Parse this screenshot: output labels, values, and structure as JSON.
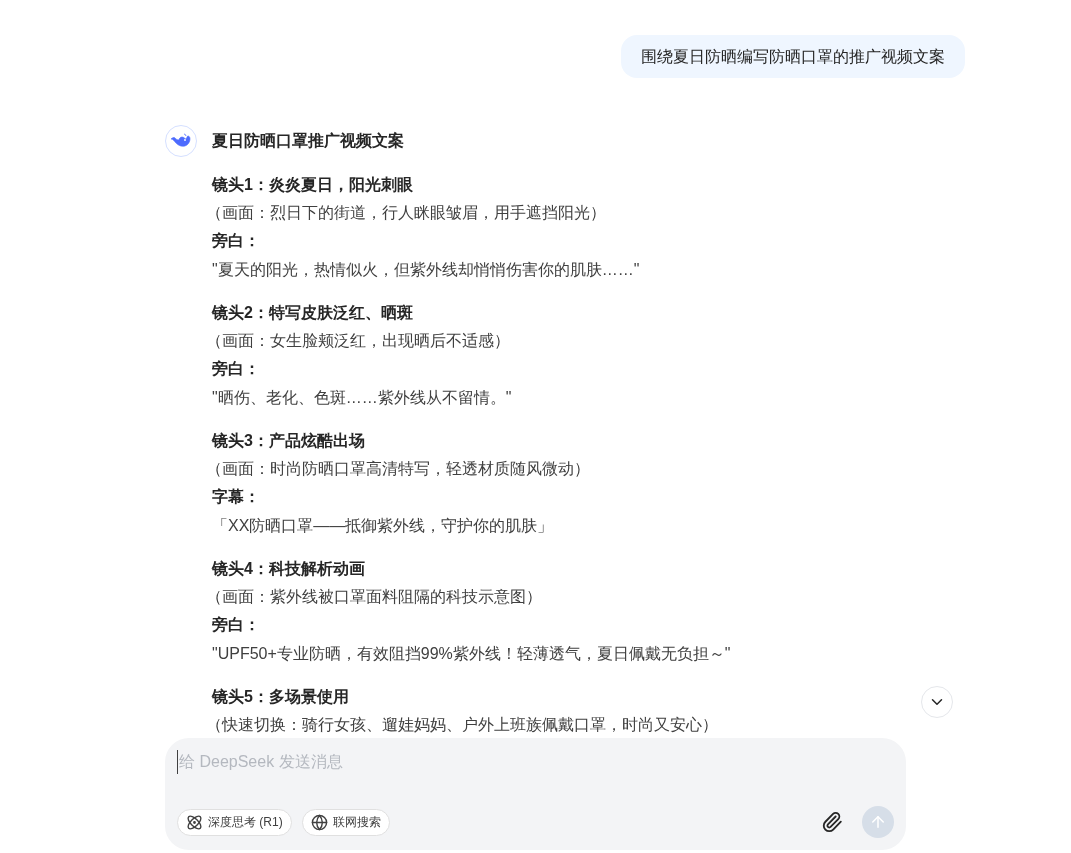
{
  "user_message": "围绕夏日防晒编写防晒口罩的推广视频文案",
  "reply": {
    "title": "夏日防晒口罩推广视频文案",
    "scenes": [
      {
        "title": "镜头1：炎炎夏日，阳光刺眼",
        "description": "（画面：烈日下的街道，行人眯眼皱眉，用手遮挡阳光）",
        "label": "旁白：",
        "line": "\"夏天的阳光，热情似火，但紫外线却悄悄伤害你的肌肤……\""
      },
      {
        "title": "镜头2：特写皮肤泛红、晒斑",
        "description": "（画面：女生脸颊泛红，出现晒后不适感）",
        "label": "旁白：",
        "line": "\"晒伤、老化、色斑……紫外线从不留情。\""
      },
      {
        "title": "镜头3：产品炫酷出场",
        "description": "（画面：时尚防晒口罩高清特写，轻透材质随风微动）",
        "label": "字幕：",
        "line": "「XX防晒口罩——抵御紫外线，守护你的肌肤」"
      },
      {
        "title": "镜头4：科技解析动画",
        "description": "（画面：紫外线被口罩面料阻隔的科技示意图）",
        "label": "旁白：",
        "line": "\"UPF50+专业防晒，有效阻挡99%紫外线！轻薄透气，夏日佩戴无负担～\""
      },
      {
        "title": "镜头5：多场景使用",
        "description": "（快速切换：骑行女孩、遛娃妈妈、户外上班族佩戴口罩，时尚又安心）"
      }
    ]
  },
  "composer": {
    "placeholder": "给 DeepSeek 发送消息",
    "toggles": [
      {
        "kind": "think",
        "label": "深度思考 (R1)",
        "selected": false
      },
      {
        "kind": "search",
        "label": "联网搜索",
        "selected": false
      }
    ],
    "send_disabled": true
  }
}
